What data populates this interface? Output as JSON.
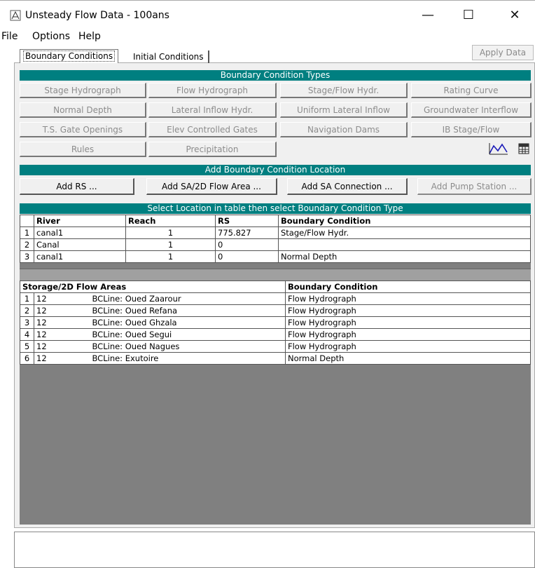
{
  "window": {
    "title": "Unsteady Flow Data - 100ans",
    "minimize": "—",
    "maximize": "☐",
    "close": "✕"
  },
  "menu": [
    "File",
    "Options",
    "Help"
  ],
  "tabs": {
    "boundary": "Boundary Conditions",
    "initial": "Initial Conditions",
    "apply": "Apply Data"
  },
  "bc_types": {
    "header": "Boundary Condition Types",
    "rows": [
      [
        "Stage Hydrograph",
        "Flow Hydrograph",
        "Stage/Flow Hydr.",
        "Rating Curve"
      ],
      [
        "Normal Depth",
        "Lateral Inflow Hydr.",
        "Uniform Lateral Inflow",
        "Groundwater Interflow"
      ],
      [
        "T.S. Gate Openings",
        "Elev Controlled Gates",
        "Navigation Dams",
        "IB Stage/Flow"
      ],
      [
        "Rules",
        "Precipitation"
      ]
    ],
    "plot_icon": "plot-icon",
    "table_icon": "table-icon"
  },
  "add_location": {
    "header": "Add Boundary Condition Location",
    "buttons": [
      "Add RS ...",
      "Add SA/2D Flow Area ...",
      "Add SA Connection ...",
      "Add Pump Station ..."
    ]
  },
  "table": {
    "header": "Select Location in table then select Boundary Condition Type",
    "columns": [
      "River",
      "Reach",
      "RS",
      "Boundary Condition"
    ],
    "rows": [
      {
        "n": "1",
        "river": "canal1",
        "reach": "1",
        "rs": "775.827",
        "bc": "Stage/Flow Hydr."
      },
      {
        "n": "2",
        "river": "Canal",
        "reach": "1",
        "rs": "0",
        "bc": ""
      },
      {
        "n": "3",
        "river": "canal1",
        "reach": "1",
        "rs": "0",
        "bc": "Normal Depth"
      }
    ],
    "storage_columns": [
      "Storage/2D Flow Areas",
      "Boundary Condition"
    ],
    "storage_rows": [
      {
        "n": "1",
        "area": "12",
        "line": "BCLine: Oued Zaarour",
        "bc": "Flow Hydrograph"
      },
      {
        "n": "2",
        "area": "12",
        "line": "BCLine: Oued Refana",
        "bc": "Flow Hydrograph"
      },
      {
        "n": "3",
        "area": "12",
        "line": "BCLine: Oued Ghzala",
        "bc": "Flow Hydrograph"
      },
      {
        "n": "4",
        "area": "12",
        "line": "BCLine: Oued Segui",
        "bc": "Flow Hydrograph"
      },
      {
        "n": "5",
        "area": "12",
        "line": "BCLine: Oued Nagues",
        "bc": "Flow Hydrograph"
      },
      {
        "n": "6",
        "area": "12",
        "line": "BCLine: Exutoire",
        "bc": "Normal Depth"
      }
    ]
  }
}
